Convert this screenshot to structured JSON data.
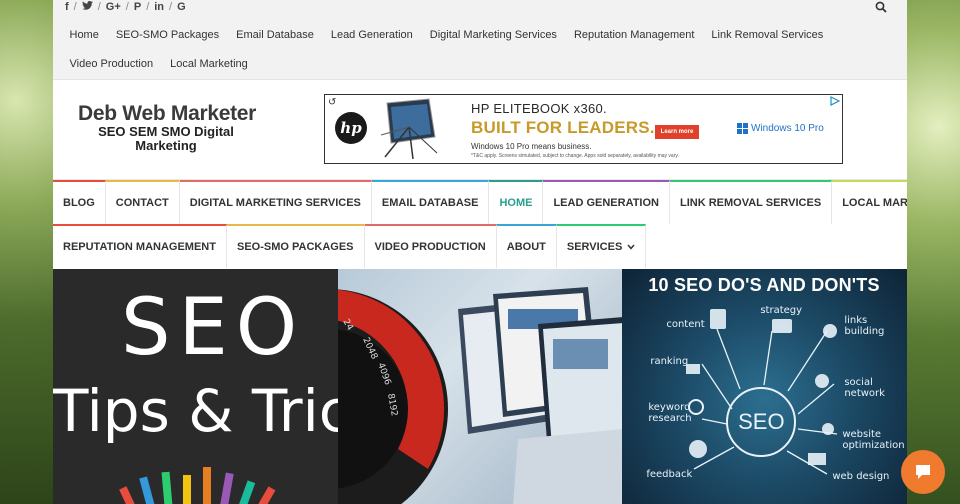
{
  "social": {
    "icons": [
      "facebook-icon",
      "twitter-icon",
      "google-plus-icon",
      "pinterest-icon",
      "linkedin-icon",
      "google-icon"
    ],
    "glyphs": [
      "f",
      "y",
      "G+",
      "P",
      "in",
      "G"
    ]
  },
  "topmenu": {
    "items": [
      "Home",
      "SEO-SMO Packages",
      "Email Database",
      "Lead Generation",
      "Digital Marketing Services",
      "Reputation Management",
      "Link Removal Services",
      "Video Production",
      "Local Marketing"
    ]
  },
  "header": {
    "site_title": "Deb Web Marketer",
    "tagline": "SEO SEM SMO Digital Marketing"
  },
  "ad": {
    "brand": "hp",
    "headline1": "HP ELITEBOOK x360.",
    "headline2": "BUILT FOR LEADERS.",
    "small1": "Windows 10 Pro means business.",
    "small2": "*T&C apply. Screens simulated, subject to change. Apps sold separately, availability may vary.",
    "cta": "Learn more",
    "windows": "Windows 10 Pro"
  },
  "mainnav": {
    "row1": [
      {
        "label": "BLOG",
        "color": "#e74c3c"
      },
      {
        "label": "CONTACT",
        "color": "#e6b84a"
      },
      {
        "label": "DIGITAL MARKETING SERVICES",
        "color": "#e06b6b"
      },
      {
        "label": "EMAIL DATABASE",
        "color": "#3aa6d8"
      },
      {
        "label": "HOME",
        "color": "#2a9d8f"
      },
      {
        "label": "LEAD GENERATION",
        "color": "#9b59b6"
      },
      {
        "label": "LINK REMOVAL SERVICES",
        "color": "#2ecc71"
      },
      {
        "label": "LOCAL MARKETING",
        "color": "#c8d95a"
      }
    ],
    "row2": [
      {
        "label": "REPUTATION MANAGEMENT",
        "color": "#e74c3c"
      },
      {
        "label": "SEO-SMO PACKAGES",
        "color": "#e6b84a"
      },
      {
        "label": "VIDEO PRODUCTION",
        "color": "#e06b6b"
      },
      {
        "label": "ABOUT",
        "color": "#3aa6d8"
      },
      {
        "label": "SERVICES",
        "color": "#2ecc71"
      }
    ],
    "active": "HOME"
  },
  "tiles": {
    "tile1": {
      "line1": "SEO",
      "line2": "Tips & Tricks"
    },
    "tile3": {
      "title": "10 SEO DO'S AND DON'TS",
      "center": "SEO",
      "labels": [
        "content",
        "strategy",
        "links building",
        "ranking",
        "social network",
        "keyword research",
        "website optimization",
        "feedback",
        "web design"
      ]
    }
  },
  "colors": {
    "accent": "#2a9d8f",
    "chat": "#f07a2d"
  }
}
